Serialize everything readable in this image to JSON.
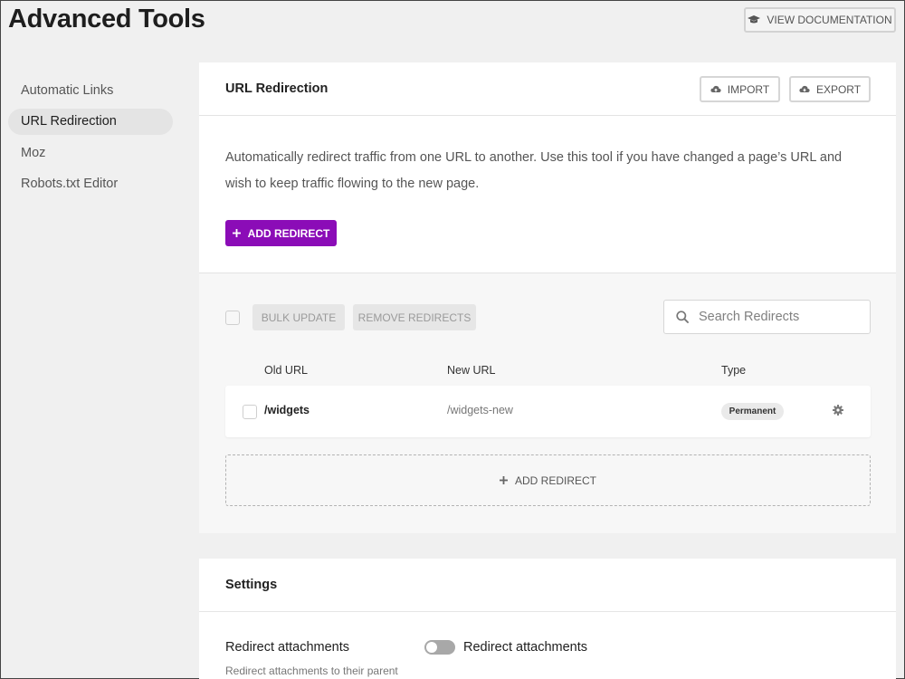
{
  "page": {
    "title": "Advanced Tools"
  },
  "header": {
    "view_docs_label": "VIEW DOCUMENTATION"
  },
  "sidebar": {
    "items": [
      {
        "label": "Automatic Links"
      },
      {
        "label": "URL Redirection"
      },
      {
        "label": "Moz"
      },
      {
        "label": "Robots.txt Editor"
      }
    ],
    "active": "URL Redirection"
  },
  "redirection": {
    "title": "URL Redirection",
    "import_label": "IMPORT",
    "export_label": "EXPORT",
    "description": "Automatically redirect traffic from one URL to another. Use this tool if you have changed a page’s URL and wish to keep traffic flowing to the new page.",
    "add_button_label": "ADD REDIRECT",
    "bulk_update_label": "BULK UPDATE",
    "remove_label": "REMOVE REDIRECTS",
    "search_placeholder": "Search Redirects",
    "columns": {
      "old": "Old URL",
      "new": "New URL",
      "type": "Type"
    },
    "rows": [
      {
        "old_url": "/widgets",
        "new_url": "/widgets-new",
        "type": "Permanent"
      }
    ],
    "add_row_label": "ADD REDIRECT"
  },
  "settings": {
    "title": "Settings",
    "label": "Redirect attachments",
    "toggle_label": "Redirect attachments",
    "toggle_on": false,
    "description": "Redirect attachments to their parent"
  },
  "colors": {
    "accent": "#8b0cb7",
    "background": "#f0f0f0",
    "card": "#ffffff"
  },
  "icons": {
    "view_docs": "graduation-cap-icon",
    "import": "cloud-upload-icon",
    "export": "cloud-download-icon",
    "search": "search-icon",
    "row_settings": "gear-icon",
    "add": "plus-icon"
  }
}
